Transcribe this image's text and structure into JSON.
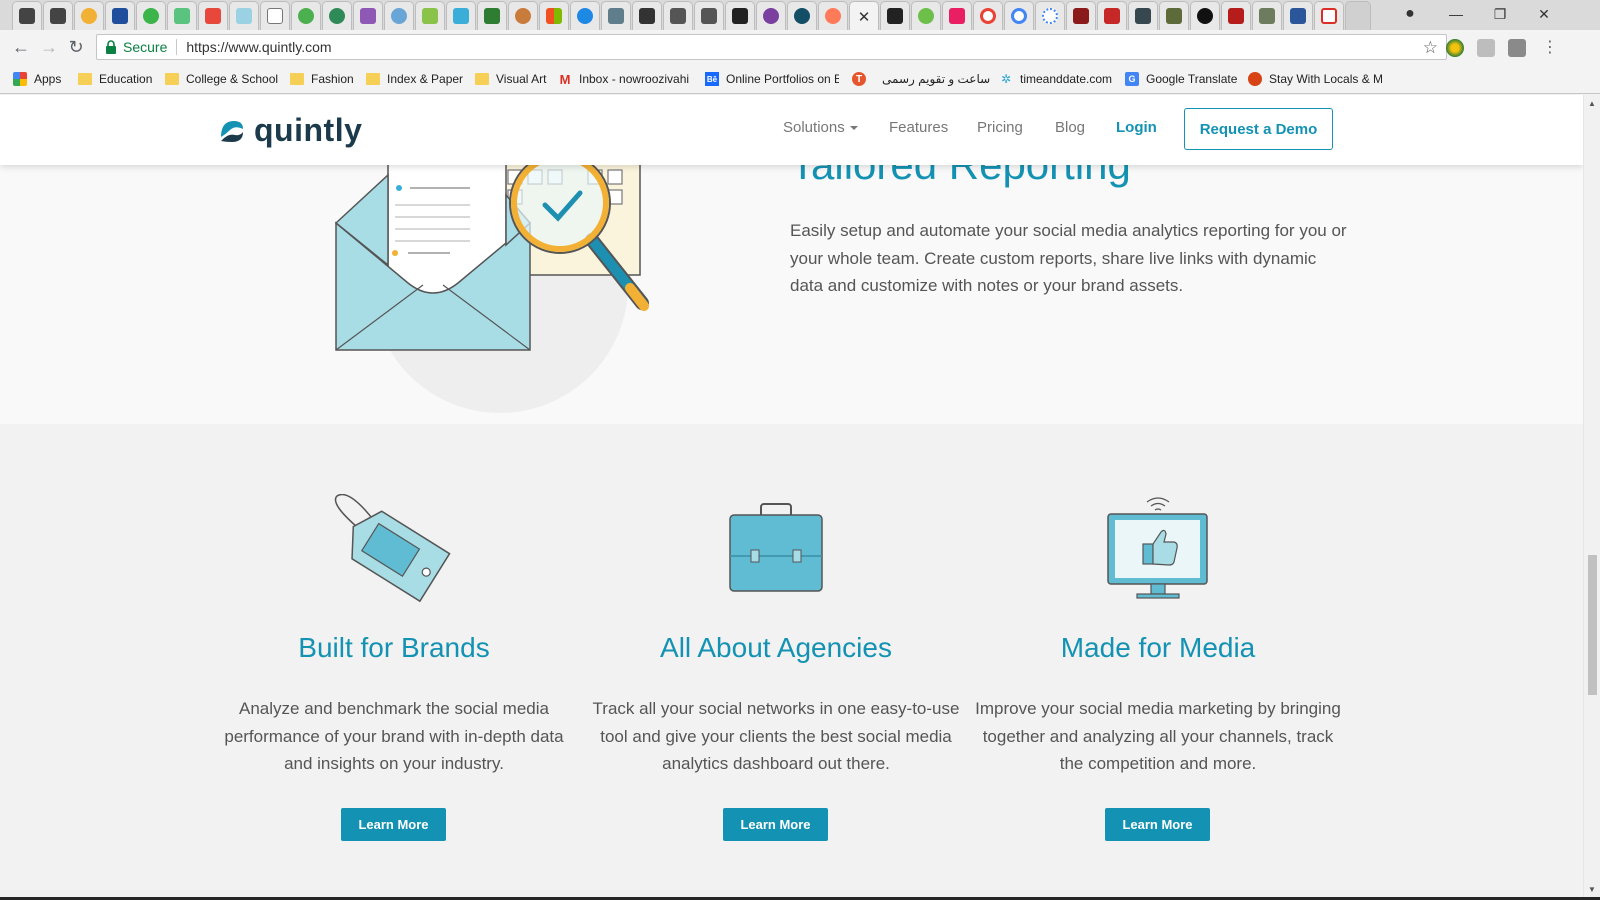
{
  "browser": {
    "address": {
      "secure_label": "Secure",
      "url": "https://www.quintly.com"
    },
    "bookmarks": [
      {
        "label": "Apps",
        "icon": "apps-grid-icon"
      },
      {
        "label": "Education",
        "icon": "folder-icon"
      },
      {
        "label": "College & School",
        "icon": "folder-icon"
      },
      {
        "label": "Fashion",
        "icon": "folder-icon"
      },
      {
        "label": "Index & Paper",
        "icon": "folder-icon"
      },
      {
        "label": "Visual Art",
        "icon": "folder-icon"
      },
      {
        "label": "Inbox - nowroozivahi",
        "icon": "gmail-icon"
      },
      {
        "label": "Online Portfolios on B",
        "icon": "behance-icon"
      },
      {
        "label": "",
        "icon": "t-icon"
      },
      {
        "label": "ساعت و تقویم رسمی",
        "icon": "none"
      },
      {
        "label": "timeanddate.com",
        "icon": "timeanddate-icon"
      },
      {
        "label": "Google Translate",
        "icon": "translate-icon"
      },
      {
        "label": "Stay With Locals & M",
        "icon": "stay-icon"
      }
    ],
    "window_controls": {
      "minimize": "—",
      "restore": "❐",
      "close": "✕"
    }
  },
  "site": {
    "logo_text": "quintly",
    "nav": {
      "solutions": "Solutions",
      "features": "Features",
      "pricing": "Pricing",
      "blog": "Blog",
      "login": "Login",
      "demo": "Request a Demo"
    },
    "reporting": {
      "title": "Tailored Reporting",
      "text": "Easily setup and automate your social media analytics reporting for you or your whole team. Create custom reports, share live links with dynamic data and customize with notes or your brand assets."
    },
    "features": [
      {
        "title": "Built for Brands",
        "text": "Analyze and benchmark the social media performance of your brand with in-depth data and insights on your industry.",
        "button": "Learn More",
        "icon": "price-tag-icon"
      },
      {
        "title": "All About Agencies",
        "text": "Track all your social networks in one easy-to-use tool and give your clients the best social media analytics dashboard out there.",
        "button": "Learn More",
        "icon": "briefcase-icon"
      },
      {
        "title": "Made for Media",
        "text": "Improve your social media marketing by bringing together and analyzing all your channels, track the competition and more.",
        "button": "Learn More",
        "icon": "monitor-thumbs-up-icon"
      }
    ]
  },
  "colors": {
    "brand_blue": "#1492b3",
    "logo_dark": "#1b3a4b",
    "folder_yellow": "#f6cf57"
  }
}
